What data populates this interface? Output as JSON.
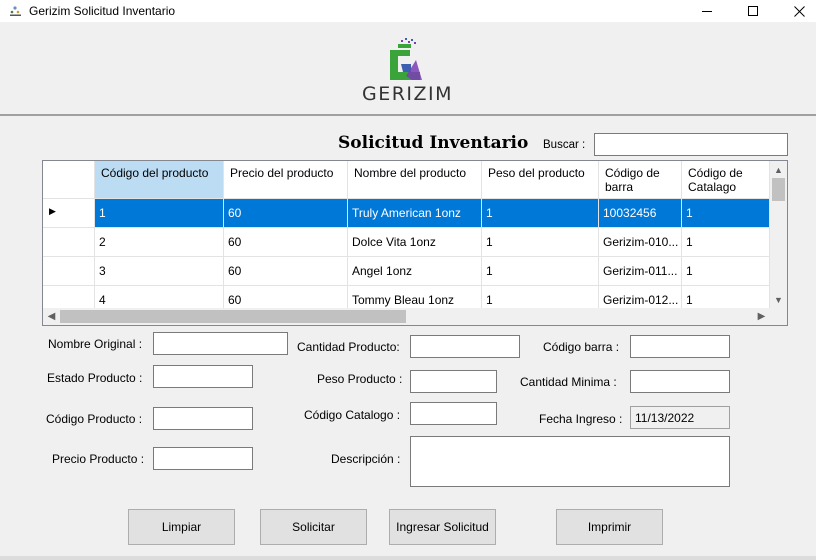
{
  "window": {
    "title": "Gerizim Solicitud Inventario",
    "controls": {
      "minimize": "─",
      "maximize": "☐",
      "close": "✕"
    }
  },
  "header": {
    "logo_text": "GERIZIM",
    "logo_icon": "gerizim-logo",
    "brand_colors": {
      "green": "#3aa33a",
      "blue": "#3d5fb0",
      "purple": "#7a3db5"
    }
  },
  "form_title": "Solicitud Inventario",
  "search": {
    "label": "Buscar :",
    "value": ""
  },
  "grid": {
    "columns": [
      "Código del producto",
      "Precio del producto",
      "Nombre del producto",
      "Peso del producto",
      "Código de barra",
      "Código de Catalago"
    ],
    "rows": [
      [
        "1",
        "60",
        "Truly American 1onz",
        "1",
        "10032456",
        "1"
      ],
      [
        "2",
        "60",
        "Dolce Vita 1onz",
        "1",
        "Gerizim-010...",
        "1"
      ],
      [
        "3",
        "60",
        "Angel 1onz",
        "1",
        "Gerizim-011...",
        "1"
      ],
      [
        "4",
        "60",
        "Tommy Bleau 1onz",
        "1",
        "Gerizim-012...",
        "1"
      ]
    ],
    "selected_row": 0,
    "row_indicator": "▶",
    "scroll": {
      "up": "▲",
      "down": "▼",
      "left": "◀",
      "right": "▶"
    }
  },
  "fields": {
    "nombre_original": {
      "label": "Nombre Original :",
      "value": ""
    },
    "estado_producto": {
      "label": "Estado Producto :",
      "value": ""
    },
    "codigo_producto": {
      "label": "Código Producto :",
      "value": ""
    },
    "precio_producto": {
      "label": "Precio Producto :",
      "value": ""
    },
    "cantidad_producto": {
      "label": "Cantidad Producto:",
      "value": ""
    },
    "peso_producto": {
      "label": "Peso Producto :",
      "value": ""
    },
    "codigo_catalogo": {
      "label": "Código Catalogo :",
      "value": ""
    },
    "descripcion": {
      "label": "Descripción :",
      "value": ""
    },
    "codigo_barra": {
      "label": "Código barra :",
      "value": ""
    },
    "cantidad_minima": {
      "label": "Cantidad Minima :",
      "value": ""
    },
    "fecha_ingreso": {
      "label": "Fecha Ingreso :",
      "value": "11/13/2022"
    }
  },
  "buttons": {
    "limpiar": "Limpiar",
    "solicitar": "Solicitar",
    "ingresar": "Ingresar Solicitud",
    "imprimir": "Imprimir"
  }
}
